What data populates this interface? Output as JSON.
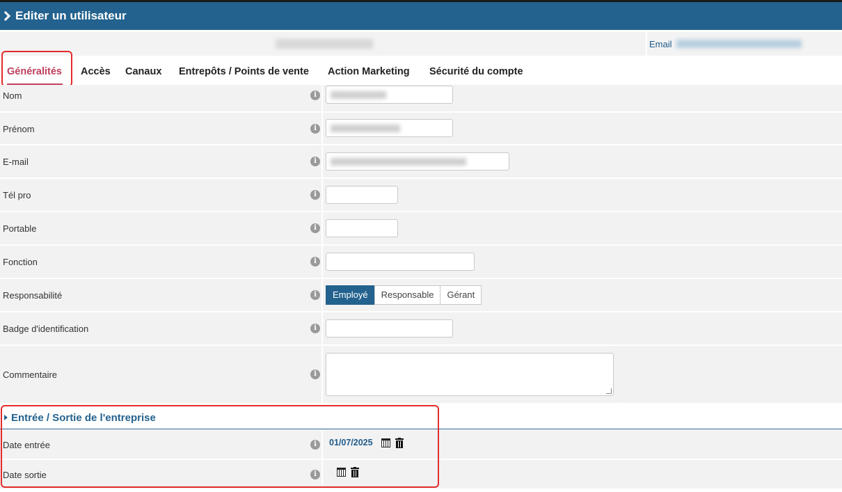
{
  "header": {
    "title": "Editer un utilisateur"
  },
  "info_bar": {
    "email_label": "Email"
  },
  "tabs": [
    {
      "label": "Généralités",
      "active": true
    },
    {
      "label": "Accès"
    },
    {
      "label": "Canaux"
    },
    {
      "label": "Entrepôts / Points de vente"
    },
    {
      "label": "Action Marketing"
    },
    {
      "label": "Sécurité du compte"
    }
  ],
  "fields": {
    "nom": {
      "label": "Nom"
    },
    "prenom": {
      "label": "Prénom"
    },
    "email": {
      "label": "E-mail"
    },
    "tel_pro": {
      "label": "Tél pro"
    },
    "portable": {
      "label": "Portable"
    },
    "fonction": {
      "label": "Fonction"
    },
    "responsabilite": {
      "label": "Responsabilité",
      "options": [
        "Employé",
        "Responsable",
        "Gérant"
      ],
      "selected": "Employé"
    },
    "badge": {
      "label": "Badge d'identification"
    },
    "commentaire": {
      "label": "Commentaire"
    }
  },
  "section_entree_sortie": {
    "title": "Entrée / Sortie de l'entreprise",
    "date_entree": {
      "label": "Date entrée",
      "value": "01/07/2025"
    },
    "date_sortie": {
      "label": "Date sortie"
    }
  },
  "icons": {
    "info": "info-icon",
    "calendar": "calendar-icon",
    "trash": "trash-icon"
  },
  "colors": {
    "header_bg": "#23628e",
    "active_tab": "#c0405e",
    "highlight": "#e32b2b"
  }
}
